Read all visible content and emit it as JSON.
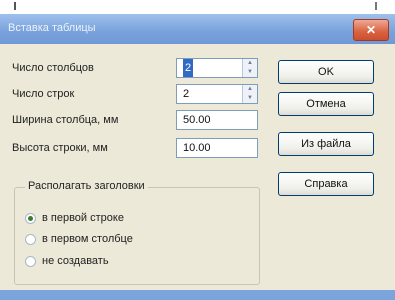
{
  "window": {
    "title": "Вставка таблицы",
    "close_label": "✕"
  },
  "form": {
    "columns": {
      "label": "Число столбцов",
      "value": "2"
    },
    "rows": {
      "label": "Число строк",
      "value": "2"
    },
    "col_width": {
      "label": "Ширина столбца, мм",
      "value": "50.00"
    },
    "row_height": {
      "label": "Высота строки, мм",
      "value": "10.00"
    }
  },
  "buttons": {
    "ok": "OK",
    "cancel": "Отмена",
    "from_file": "Из файла",
    "help": "Справка"
  },
  "header_group": {
    "title": "Располагать заголовки",
    "options": [
      {
        "label": "в первой строке",
        "checked": true
      },
      {
        "label": "в первом столбце",
        "checked": false
      },
      {
        "label": "не создавать",
        "checked": false
      }
    ]
  }
}
